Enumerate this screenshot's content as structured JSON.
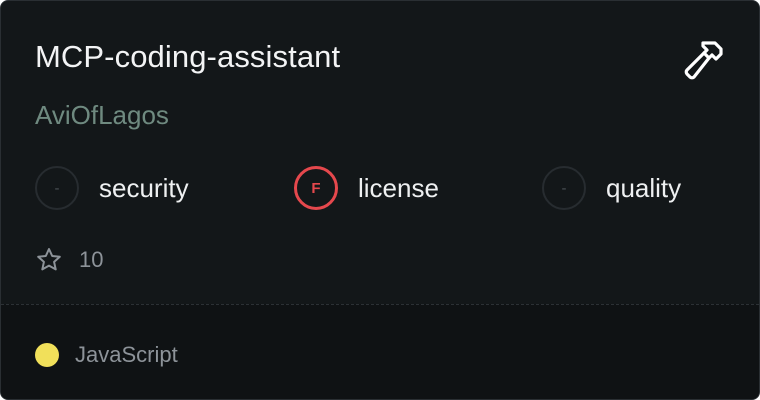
{
  "card": {
    "title": "MCP-coding-assistant",
    "owner": "AviOfLagos",
    "type_icon": "hammer-icon",
    "scores": [
      {
        "label": "security",
        "grade": "-"
      },
      {
        "label": "license",
        "grade": "F"
      },
      {
        "label": "quality",
        "grade": "-"
      }
    ],
    "stars": {
      "icon": "star-outline-icon",
      "count": "10"
    },
    "language": {
      "name": "JavaScript",
      "color": "#f1e05a"
    }
  },
  "colors": {
    "background": "#131719",
    "title": "#f3f4f5",
    "owner": "#6f8a80",
    "grade_fail": "#e5484d",
    "muted": "#8d9399"
  }
}
